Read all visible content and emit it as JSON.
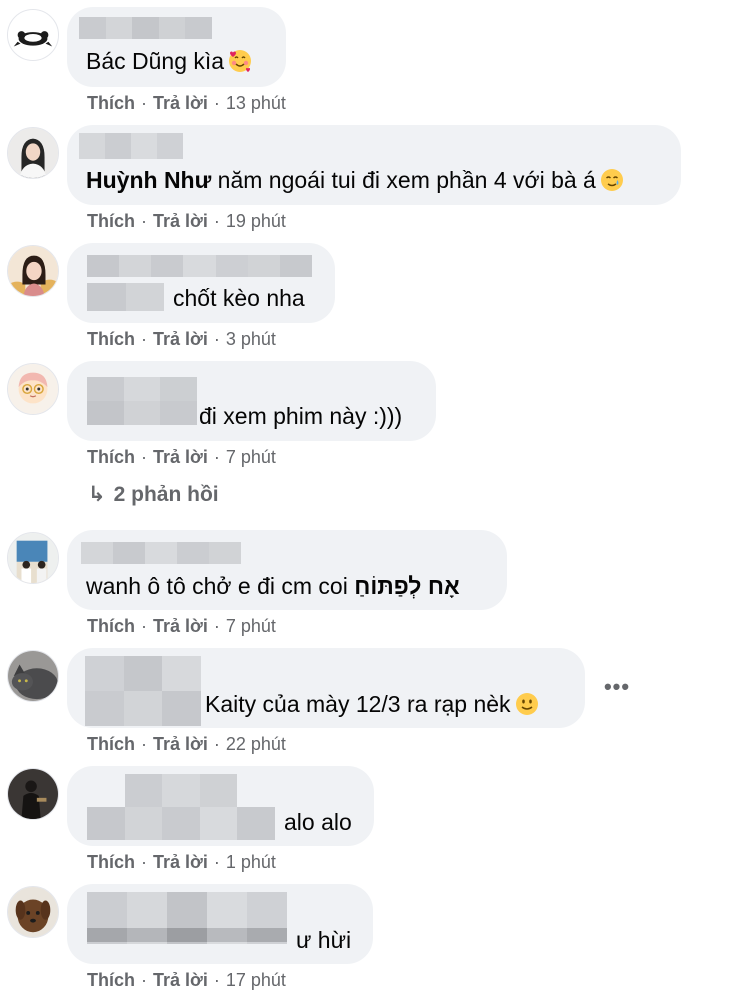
{
  "comments": [
    {
      "text": "Bác Dũng kìa",
      "emoji": "smiling-face-with-hearts-icon",
      "actions": {
        "like": "Thích",
        "reply": "Trả lời",
        "time": "13 phút"
      }
    },
    {
      "tag": "Huỳnh Như",
      "text": "năm ngoái tui đi xem phần 4 với bà á",
      "emoji": "smiling-face-with-tear-icon",
      "actions": {
        "like": "Thích",
        "reply": "Trả lời",
        "time": "19 phút"
      }
    },
    {
      "text": "chốt kèo nha",
      "actions": {
        "like": "Thích",
        "reply": "Trả lời",
        "time": "3 phút"
      }
    },
    {
      "text": "đi xem phim này :)))",
      "actions": {
        "like": "Thích",
        "reply": "Trả lời",
        "time": "7 phút"
      },
      "replies": "2 phản hồi"
    },
    {
      "text": "wanh ô tô chở e đi cm coi ",
      "text_extra": "אָח לְפַתּוֹחַ",
      "actions": {
        "like": "Thích",
        "reply": "Trả lời",
        "time": "7 phút"
      }
    },
    {
      "text": "Kaity của mày 12/3 ra rạp nèk",
      "emoji": "slightly-smiling-face-icon",
      "actions": {
        "like": "Thích",
        "reply": "Trả lời",
        "time": "22 phút"
      },
      "more": "•••"
    },
    {
      "text": "alo alo",
      "actions": {
        "like": "Thích",
        "reply": "Trả lời",
        "time": "1 phút"
      }
    },
    {
      "text": "ư hừi",
      "actions": {
        "like": "Thích",
        "reply": "Trả lời",
        "time": "17 phút"
      }
    }
  ],
  "colors": {
    "bubble": "#f0f2f5",
    "text": "#050505",
    "meta": "#65676b"
  }
}
